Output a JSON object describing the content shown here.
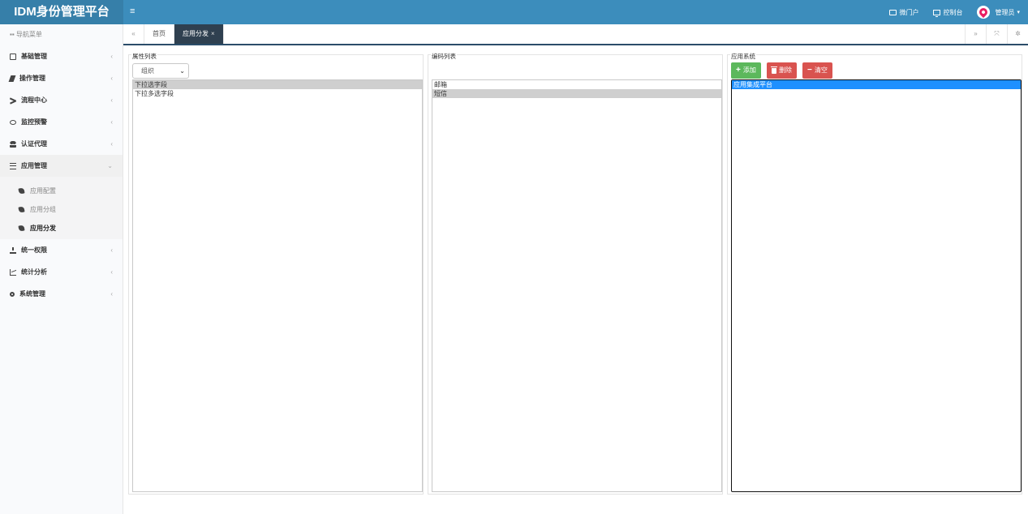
{
  "header": {
    "brand": "IDM身份管理平台",
    "menu_glyph": "≡",
    "portal": "微门户",
    "console": "控制台",
    "user": "管理员"
  },
  "sidebar": {
    "title": "导航菜单",
    "items": [
      {
        "label": "基础管理",
        "icon": "id-card-icon"
      },
      {
        "label": "操作管理",
        "icon": "pencil-icon"
      },
      {
        "label": "流程中心",
        "icon": "shuffle-icon"
      },
      {
        "label": "监控预警",
        "icon": "eye-icon"
      },
      {
        "label": "认证代理",
        "icon": "users-icon"
      },
      {
        "label": "应用管理",
        "icon": "list-icon"
      },
      {
        "label": "统一权限",
        "icon": "sitemap-icon"
      },
      {
        "label": "统计分析",
        "icon": "area-chart-icon"
      },
      {
        "label": "系统管理",
        "icon": "cogs-icon"
      }
    ],
    "sub_items": [
      "应用配置",
      "应用分组",
      "应用分发"
    ]
  },
  "tabs": {
    "home": "首页",
    "active": "应用分发",
    "close": "×"
  },
  "attr_panel": {
    "title": "属性列表",
    "select_value": "组织",
    "options": [
      "下拉选字段",
      "下拉多选字段"
    ]
  },
  "code_panel": {
    "title": "编码列表",
    "options": [
      "邮箱",
      "短信"
    ]
  },
  "app_panel": {
    "title": "应用系统",
    "add": "添加",
    "delete": "删除",
    "clear": "清空",
    "options": [
      "应用集成平台"
    ]
  }
}
